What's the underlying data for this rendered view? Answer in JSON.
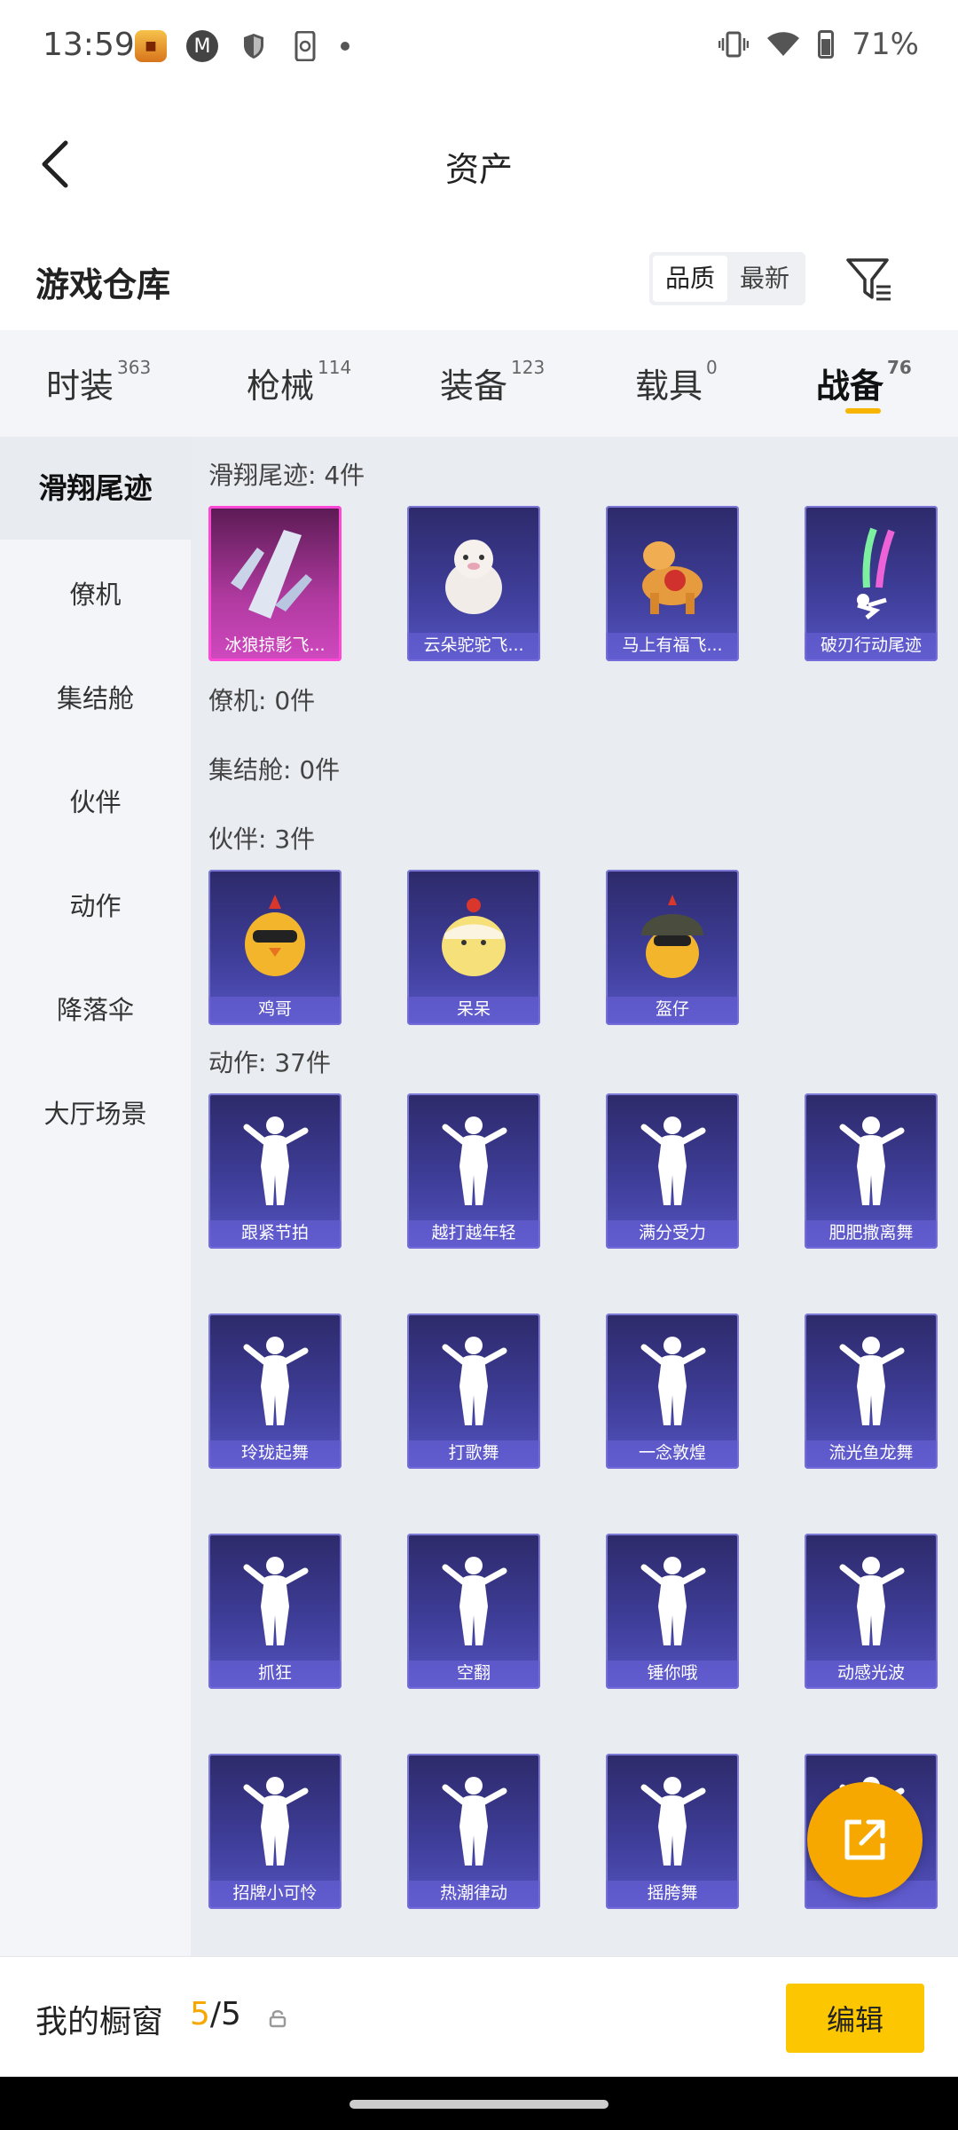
{
  "status_bar": {
    "time": "13:59",
    "battery": "71%"
  },
  "header": {
    "title": "资产"
  },
  "warehouse": {
    "title": "游戏仓库",
    "sort_options": [
      "品质",
      "最新"
    ]
  },
  "categories": [
    {
      "label": "时装",
      "count": "363"
    },
    {
      "label": "枪械",
      "count": "114"
    },
    {
      "label": "装备",
      "count": "123"
    },
    {
      "label": "载具",
      "count": "0"
    },
    {
      "label": "战备",
      "count": "76"
    }
  ],
  "sidebar": [
    "滑翔尾迹",
    "僚机",
    "集结舱",
    "伙伴",
    "动作",
    "降落伞",
    "大厅场景"
  ],
  "sections": {
    "glide": {
      "title": "滑翔尾迹: 4件",
      "items": [
        "冰狼掠影飞...",
        "云朵驼驼飞...",
        "马上有福飞...",
        "破刃行动尾迹"
      ]
    },
    "wingman": {
      "title": "僚机: 0件"
    },
    "capsule": {
      "title": "集结舱: 0件"
    },
    "partner": {
      "title": "伙伴: 3件",
      "items": [
        "鸡哥",
        "呆呆",
        "盔仔"
      ]
    },
    "emote": {
      "title": "动作: 37件",
      "items": [
        "跟紧节拍",
        "越打越年轻",
        "满分受力",
        "肥肥撒离舞",
        "玲珑起舞",
        "打歌舞",
        "一念敦煌",
        "流光鱼龙舞",
        "抓狂",
        "空翻",
        "锤你哦",
        "动感光波",
        "招牌小可怜",
        "热潮律动",
        "摇胯舞",
        ""
      ]
    }
  },
  "bottom_bar": {
    "label": "我的橱窗",
    "current": "5",
    "total": "/5",
    "edit_label": "编辑"
  },
  "colors": {
    "accent": "#f7b500",
    "edit_button": "#fcc700",
    "card_bg": "#3e3d98",
    "rare_card": "#d049c0"
  }
}
